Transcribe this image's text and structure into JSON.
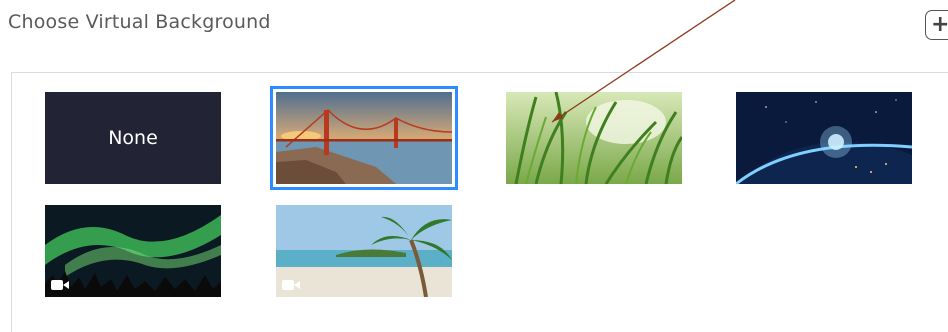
{
  "header": {
    "title": "Choose Virtual Background",
    "add_icon": "plus-icon"
  },
  "backgrounds": [
    {
      "name": "None",
      "label": "None",
      "type": "none",
      "selected": false
    },
    {
      "name": "Golden Gate Bridge",
      "type": "image",
      "selected": true
    },
    {
      "name": "Grass",
      "type": "image",
      "selected": false
    },
    {
      "name": "Earth from space",
      "type": "image",
      "selected": false
    },
    {
      "name": "Aurora",
      "type": "video",
      "selected": false
    },
    {
      "name": "Beach",
      "type": "video",
      "selected": false
    }
  ],
  "colors": {
    "selection": "#2d8cff",
    "none_tile": "#232336",
    "annotation_arrow": "#8b3a1a"
  }
}
